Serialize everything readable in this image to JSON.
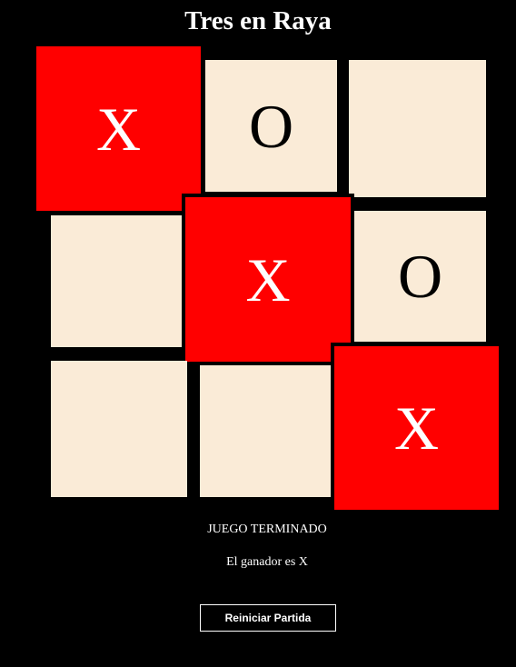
{
  "title": "Tres en Raya",
  "board": {
    "cells": [
      {
        "mark": "X",
        "winning": true
      },
      {
        "mark": "O",
        "winning": false
      },
      {
        "mark": "",
        "winning": false
      },
      {
        "mark": "",
        "winning": false
      },
      {
        "mark": "X",
        "winning": true
      },
      {
        "mark": "O",
        "winning": false
      },
      {
        "mark": "",
        "winning": false
      },
      {
        "mark": "",
        "winning": false
      },
      {
        "mark": "X",
        "winning": true
      }
    ]
  },
  "status": {
    "state_text": "JUEGO TERMINADO",
    "winner_text": "El ganador es X"
  },
  "restart_button": {
    "label": "Reiniciar Partida"
  },
  "colors": {
    "background": "#000000",
    "cell": "#faebd7",
    "winning_cell": "#ff0000",
    "text": "#ffffff"
  }
}
